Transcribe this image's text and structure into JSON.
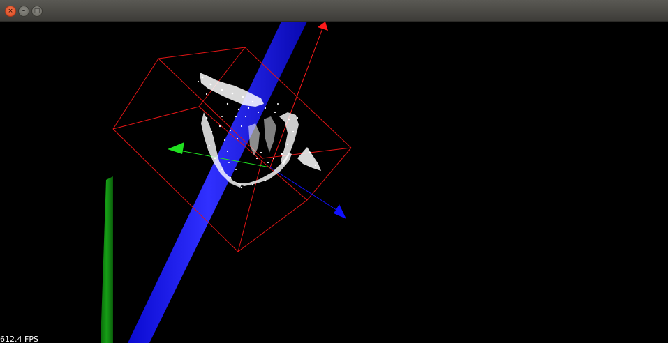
{
  "window": {
    "buttons": {
      "close_glyph": "×",
      "minimize_glyph": "–",
      "maximize_glyph": "□"
    }
  },
  "viewport": {
    "background": "#000000",
    "status": {
      "fps_text": "612.4 FPS"
    },
    "colors": {
      "bounding_box": "#e01515",
      "x_axis": "#ff1a1a",
      "y_axis": "#20e020",
      "z_axis": "#1010ff",
      "pillar_blue": "#1a1aff",
      "pillar_green": "#108010",
      "point_cloud": "#ffffff"
    }
  }
}
